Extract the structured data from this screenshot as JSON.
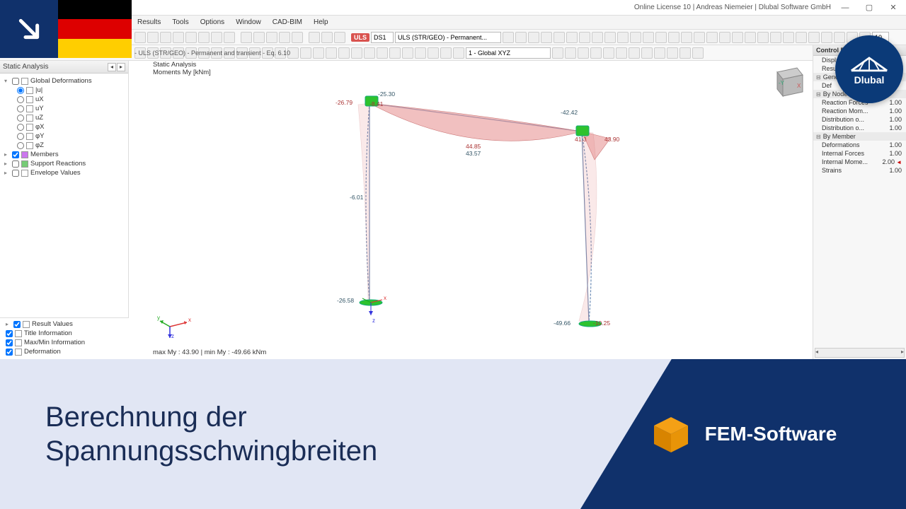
{
  "window": {
    "license": "Online License 10 | Andreas Niemeier | Dlubal Software GmbH",
    "minimize": "—",
    "maximize": "▢",
    "close": "✕"
  },
  "menu": {
    "results": "Results",
    "tools": "Tools",
    "options": "Options",
    "window": "Window",
    "cadbim": "CAD-BIM",
    "help": "Help"
  },
  "toolbar": {
    "uls": "ULS",
    "ds1": "DS1",
    "combo_uls": "ULS (STR/GEO) - Permanent...",
    "combo_global": "1 - Global XYZ",
    "spin": "10"
  },
  "breadcrumb": " - ULS (STR/GEO) - Permanent and transient - Eq. 6.10",
  "sidebar": {
    "title": "Static Analysis",
    "global_def": "Global Deformations",
    "u": "|u|",
    "ux": "uX",
    "uy": "uY",
    "uz": "uZ",
    "phix": "φX",
    "phiy": "φY",
    "phiz": "φZ",
    "members": "Members",
    "support": "Support Reactions",
    "envelope": "Envelope Values",
    "result_values": "Result Values",
    "title_info": "Title Information",
    "maxmin": "Max/Min Information",
    "deformation": "Deformation"
  },
  "viewport": {
    "line1": "Static Analysis",
    "line2": "Moments My [kNm]",
    "minmax": "max My : 43.90 | min My : -49.66 kNm",
    "axes": {
      "x": "x",
      "y": "y",
      "z": "z"
    }
  },
  "diagram": {
    "v1": "-26.79",
    "v2": "-25.30",
    "v3": "-42.42",
    "v4": "43.90",
    "v5": "44.85",
    "v6": "43.57",
    "v7": "-6.01",
    "v8": "-26.58",
    "v9": "-49.66",
    "v10": "-10.25",
    "v11": "-8.41",
    "v12": "41.3"
  },
  "ctrl": {
    "title": "Control Pa",
    "display": "Display F",
    "results": "Results",
    "general": "Genera",
    "def": "Def",
    "bynode": "By Node",
    "reaction_forces": "Reaction Forces",
    "reaction_mom": "Reaction Mom...",
    "dist1": "Distribution o...",
    "dist2": "Distribution o...",
    "bymember": "By Member",
    "deformations": "Deformations",
    "int_forces": "Internal Forces",
    "int_mom": "Internal Mome...",
    "strains": "Strains",
    "val100": "1.00",
    "val200": "2.00"
  },
  "banner": {
    "title_l1": "Berechnung der",
    "title_l2": "Spannungsschwingbreiten",
    "product": "FEM-Software"
  },
  "logo": {
    "text": "Dlubal"
  }
}
